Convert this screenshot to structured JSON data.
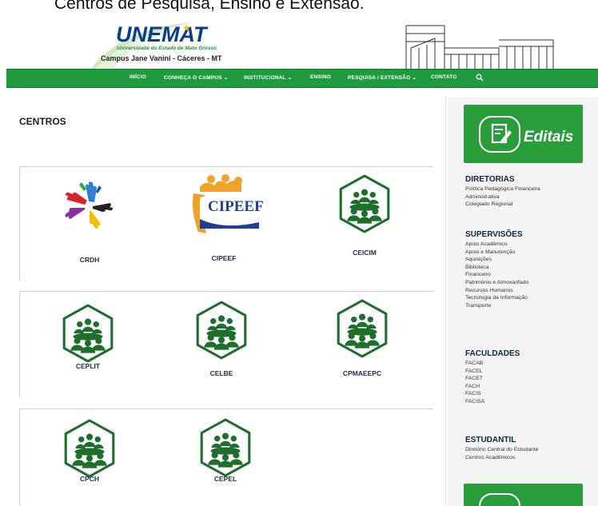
{
  "top_caption": "Centros de Pesquisa, Ensino e Extensão.",
  "logo": {
    "title": "UNEMAT",
    "subtitle": "Universidade do Estado de Mato Grosso",
    "campus": "Campus Jane Vanini - Cáceres - MT"
  },
  "nav": {
    "items": [
      {
        "label": "INÍCIO"
      },
      {
        "label": "CONHEÇA O CAMPUS ⌄"
      },
      {
        "label": "INSTITUCIONAL ⌄"
      },
      {
        "label": "ENSINO"
      },
      {
        "label": "PESQUISA / EXTENSÃO ⌄"
      },
      {
        "label": "CONTATO"
      }
    ]
  },
  "page": {
    "title": "CENTROS"
  },
  "centers": [
    {
      "label": "CRDH",
      "icon": "crdh-hands-logo"
    },
    {
      "label": "CIPEEF",
      "icon": "cipeef-logo"
    },
    {
      "label": "CEICIM",
      "icon": "group-meeting-icon"
    },
    {
      "label": "CEPLIT",
      "icon": "group-meeting-icon"
    },
    {
      "label": "CELBE",
      "icon": "group-meeting-icon"
    },
    {
      "label": "CPMAEEPC",
      "icon": "group-meeting-icon"
    },
    {
      "label": "CPCH",
      "icon": "group-meeting-icon"
    },
    {
      "label": "CEPEL",
      "icon": "group-meeting-icon"
    }
  ],
  "cipeef_logo_text": "CIPEEF",
  "sidebar": {
    "editais_label": "Editais",
    "sections": [
      {
        "heading": "DIRETORIAS",
        "links": [
          "Política Pedagógica Financeira",
          "Administrativa",
          "Colegiado Regional"
        ]
      },
      {
        "heading": "SUPERVISÕES",
        "links": [
          "Apoio Acadêmico",
          "Apoio e Manutenção",
          "Aquisições",
          "Biblioteca",
          "Financeiro",
          "Patrimônio e Almoxarifado",
          "Recursos Humanos",
          "Tecnologia da Informação",
          "Transporte"
        ]
      },
      {
        "heading": "FACULDADES",
        "links": [
          "FACAB",
          "FACEL",
          "FACET",
          "FACH",
          "FACIS",
          "FACISA"
        ]
      },
      {
        "heading": "ESTUDANTIL",
        "links": [
          "Diretório Central do Estudante",
          "Centros Acadêmicos"
        ]
      }
    ]
  },
  "colors": {
    "brand_green": "#1e9b3e",
    "editais_green": "#2a9d3b",
    "icon_green": "#1f6e2e",
    "logo_blue": "#0b3d8c",
    "cipeef_orange": "#f0a22a",
    "cipeef_blue": "#1f3f8f"
  }
}
